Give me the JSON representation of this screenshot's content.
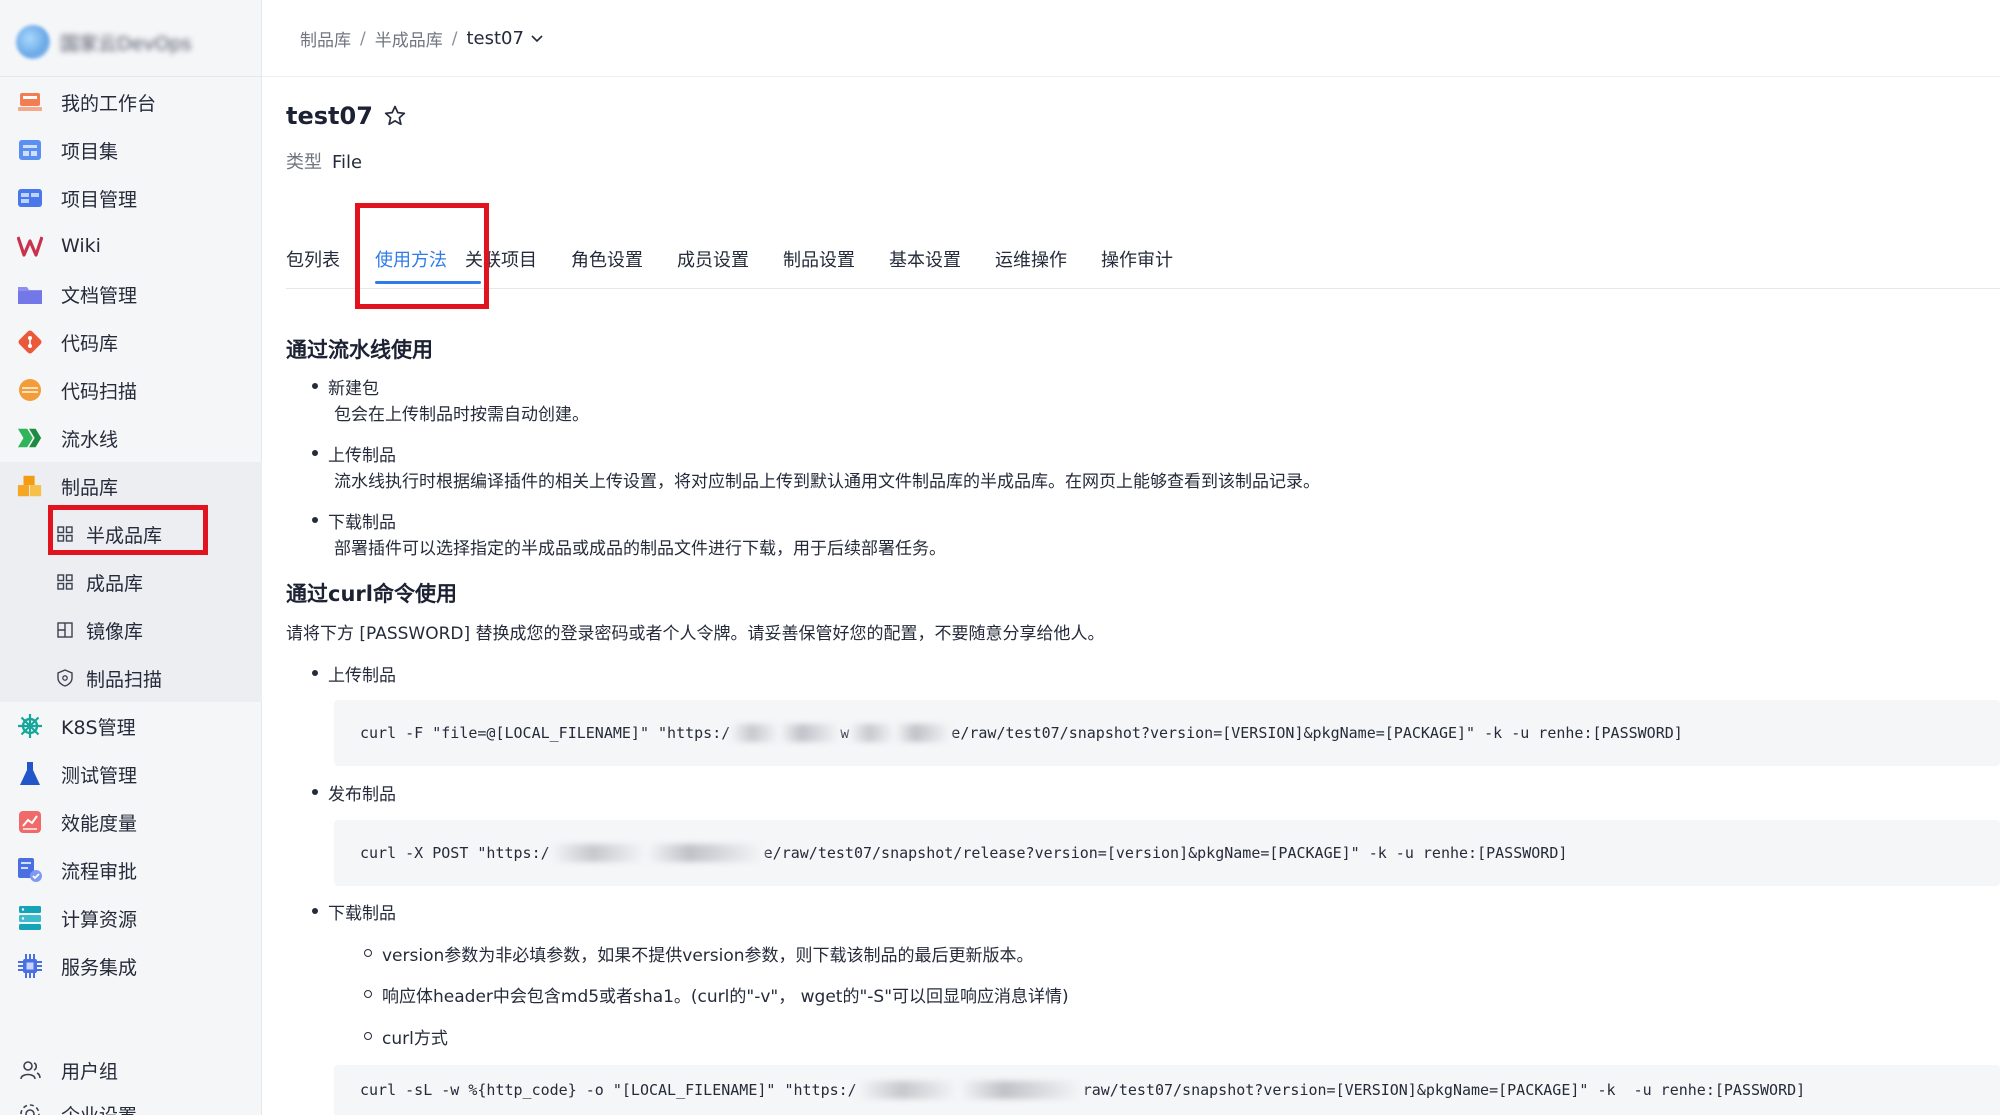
{
  "app": {
    "logo_text": "国家云DevOps"
  },
  "sidebar": {
    "items": [
      {
        "label": "我的工作台",
        "icon": "workbench-icon"
      },
      {
        "label": "项目集",
        "icon": "project-set-icon"
      },
      {
        "label": "项目管理",
        "icon": "project-manage-icon"
      },
      {
        "label": "Wiki",
        "icon": "wiki-icon"
      },
      {
        "label": "文档管理",
        "icon": "document-icon"
      },
      {
        "label": "代码库",
        "icon": "git-icon"
      },
      {
        "label": "代码扫描",
        "icon": "code-scan-icon"
      },
      {
        "label": "流水线",
        "icon": "pipeline-icon"
      },
      {
        "label": "制品库",
        "icon": "artifact-icon"
      }
    ],
    "sub_items": [
      {
        "label": "半成品库",
        "icon": "grid-icon"
      },
      {
        "label": "成品库",
        "icon": "grid-icon"
      },
      {
        "label": "镜像库",
        "icon": "image-repo-icon"
      },
      {
        "label": "制品扫描",
        "icon": "shield-icon"
      }
    ],
    "items_after": [
      {
        "label": "K8S管理",
        "icon": "helm-icon"
      },
      {
        "label": "测试管理",
        "icon": "flask-icon"
      },
      {
        "label": "效能度量",
        "icon": "metrics-icon"
      },
      {
        "label": "流程审批",
        "icon": "approval-icon"
      },
      {
        "label": "计算资源",
        "icon": "compute-icon"
      },
      {
        "label": "服务集成",
        "icon": "chip-icon"
      }
    ],
    "bottom_items": [
      {
        "label": "用户组",
        "icon": "user-group-icon"
      },
      {
        "label": "企业设置",
        "icon": "settings-icon"
      }
    ]
  },
  "breadcrumb": {
    "level1": "制品库",
    "level2": "半成品库",
    "current": "test07"
  },
  "repo": {
    "name": "test07",
    "type_label": "类型",
    "type_value": "File"
  },
  "tabs": [
    "包列表",
    "使用方法",
    "关联项目",
    "角色设置",
    "成员设置",
    "制品设置",
    "基本设置",
    "运维操作",
    "操作审计"
  ],
  "content": {
    "section1_title": "通过流水线使用",
    "s1_items": [
      {
        "title": "新建包",
        "desc": "包会在上传制品时按需自动创建。"
      },
      {
        "title": "上传制品",
        "desc": "流水线执行时根据编译插件的相关上传设置，将对应制品上传到默认通用文件制品库的半成品库。在网页上能够查看到该制品记录。"
      },
      {
        "title": "下载制品",
        "desc": "部署插件可以选择指定的半成品或成品的制品文件进行下载，用于后续部署任务。"
      }
    ],
    "section2_title": "通过curl命令使用",
    "section2_intro": "请将下方 [PASSWORD] 替换成您的登录密码或者个人令牌。请妥善保管好您的配置，不要随意分享给他人。",
    "upload_title": "上传制品",
    "upload_code_a": "curl -F \"file=@[LOCAL_FILENAME]\" \"https:/",
    "upload_code_mid": "w",
    "upload_code_b": "e/raw/test07/snapshot?version=[VERSION]&pkgName=[PACKAGE]\" -k -u renhe:[PASSWORD]",
    "release_title": "发布制品",
    "release_code_a": "curl -X POST \"https:/",
    "release_code_b": "e/raw/test07/snapshot/release?version=[version]&pkgName=[PACKAGE]\" -k -u renhe:[PASSWORD]",
    "download_title": "下载制品",
    "download_notes": [
      "version参数为非必填参数，如果不提供version参数，则下载该制品的最后更新版本。",
      "响应体header中会包含md5或者sha1。(curl的\"-v\"， wget的\"-S\"可以回显响应消息详情)",
      "curl方式"
    ],
    "download_code_a": "curl -sL -w %{http_code} -o \"[LOCAL_FILENAME]\" \"https:/",
    "download_code_b": "raw/test07/snapshot?version=[VERSION]&pkgName=[PACKAGE]\" -k  -u renhe:[PASSWORD]"
  },
  "colors": {
    "accent": "#2f7ce8",
    "highlight": "#e0131e",
    "sidebar_bg": "#f5f6f8"
  }
}
